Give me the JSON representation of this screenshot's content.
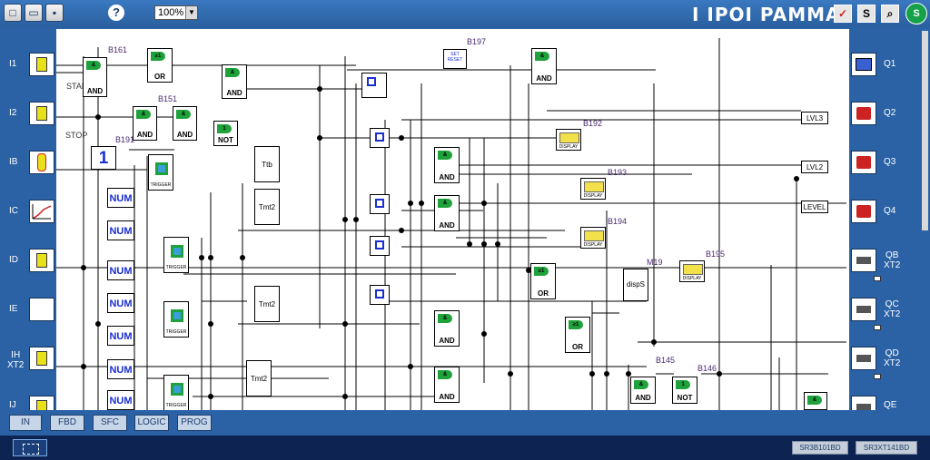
{
  "toolbar": {
    "zoom_value": "100%",
    "help_label": "?",
    "brand_text": "I IPOI PAMMA",
    "btn_s": "S",
    "logo_text": "S"
  },
  "inputs": [
    {
      "label": "I1"
    },
    {
      "label": "I2"
    },
    {
      "label": "IB"
    },
    {
      "label": "IC"
    },
    {
      "label": "ID"
    },
    {
      "label": "IE"
    },
    {
      "label": "IH\nXT2"
    },
    {
      "label": "IJ"
    }
  ],
  "outputs": [
    {
      "label": "Q1"
    },
    {
      "label": "Q2"
    },
    {
      "label": "Q3"
    },
    {
      "label": "Q4"
    },
    {
      "label": "QB\nXT2"
    },
    {
      "label": "QC\nXT2"
    },
    {
      "label": "QD\nXT2"
    },
    {
      "label": "QE"
    }
  ],
  "blocks": {
    "b161": "B161",
    "b151": "B151",
    "b191": "B191",
    "b197": "B197",
    "b192": "B192",
    "b193": "B193",
    "b194": "B194",
    "b195": "B195",
    "m19": "M19",
    "b145": "B145",
    "b146": "B146",
    "and": "AND",
    "or": "OR",
    "not": "NOT",
    "trigger": "TRIGGER",
    "num": "NUM",
    "one": "1",
    "tth": "Ttb",
    "tmt2": "Tmt2",
    "disp": "DISPLAY",
    "disps": "dispS",
    "lvl3": "LVL3",
    "lvl2": "LVL2",
    "level": "LEVEL",
    "start": "START",
    "stop": "STOP",
    "set": "SET",
    "reset": "RESET"
  },
  "tabs": [
    {
      "label": "IN"
    },
    {
      "label": "FBD"
    },
    {
      "label": "SFC"
    },
    {
      "label": "LOGIC"
    },
    {
      "label": "PROG"
    }
  ],
  "status": {
    "device1": "SR3B101BD",
    "device2": "SR3XT141BD"
  },
  "colors": {
    "frame": "#2b62a6",
    "status_bar": "#0d2452",
    "gate_green": "#1fa23c",
    "num_blue": "#1a2fd1",
    "display_yellow": "#f2e14a"
  }
}
